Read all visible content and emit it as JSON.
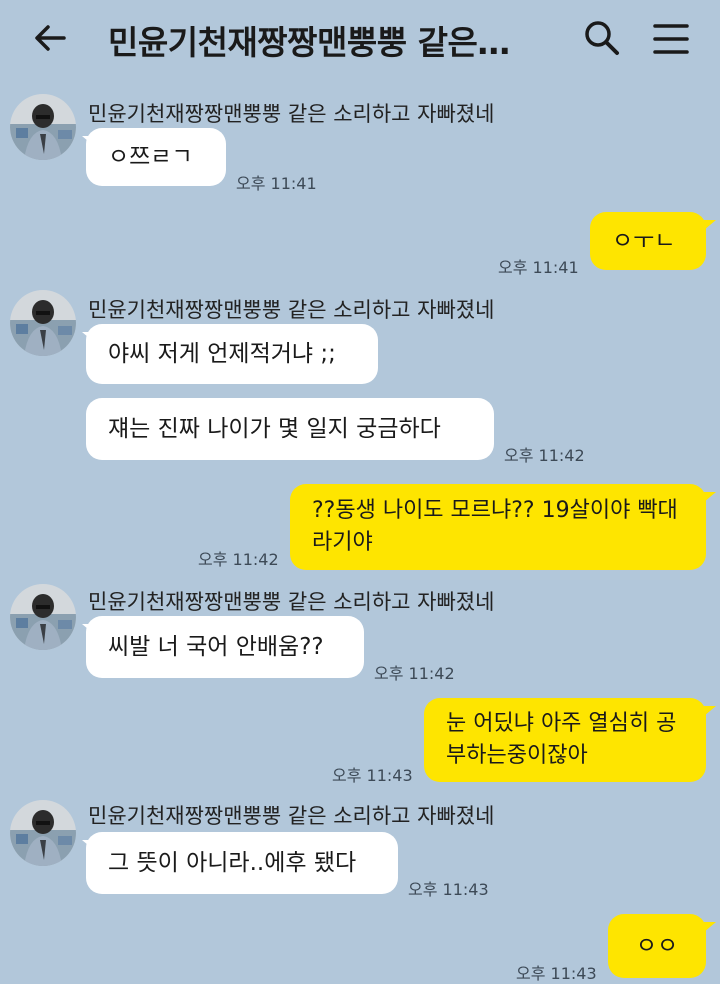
{
  "header": {
    "title": "민윤기천재짱짱맨뿡뿡 같은…"
  },
  "sender_name": "민윤기천재짱짱맨뿡뿡 같은 소리하고 자빠졌네",
  "colors": {
    "background": "#b2c7da",
    "incoming_bubble": "#ffffff",
    "outgoing_bubble": "#fee500"
  },
  "messages": [
    {
      "dir": "in",
      "text": "ㅇ쯔ㄹㄱ",
      "time": "오후 11:41"
    },
    {
      "dir": "out",
      "text": "ㅇㅜㄴ",
      "time": "오후 11:41"
    },
    {
      "dir": "in",
      "text": "야씨 저게 언제적거냐 ;;"
    },
    {
      "dir": "in",
      "text": "쟤는 진짜 나이가 몇 일지 궁금하다",
      "time": "오후 11:42"
    },
    {
      "dir": "out",
      "text": "??동생 나이도 모르냐?? 19살이야 빡대라기야",
      "time": "오후 11:42"
    },
    {
      "dir": "in",
      "text": "씨발 너 국어 안배움??",
      "time": "오후 11:42"
    },
    {
      "dir": "out",
      "text": "눈 어딨냐 아주 열심히 공부하는중이잖아",
      "time": "오후 11:43"
    },
    {
      "dir": "in",
      "text": "그 뜻이 아니라..에후 됐다",
      "time": "오후 11:43"
    },
    {
      "dir": "out",
      "text": "ㅇㅇ",
      "time": "오후 11:43"
    }
  ]
}
